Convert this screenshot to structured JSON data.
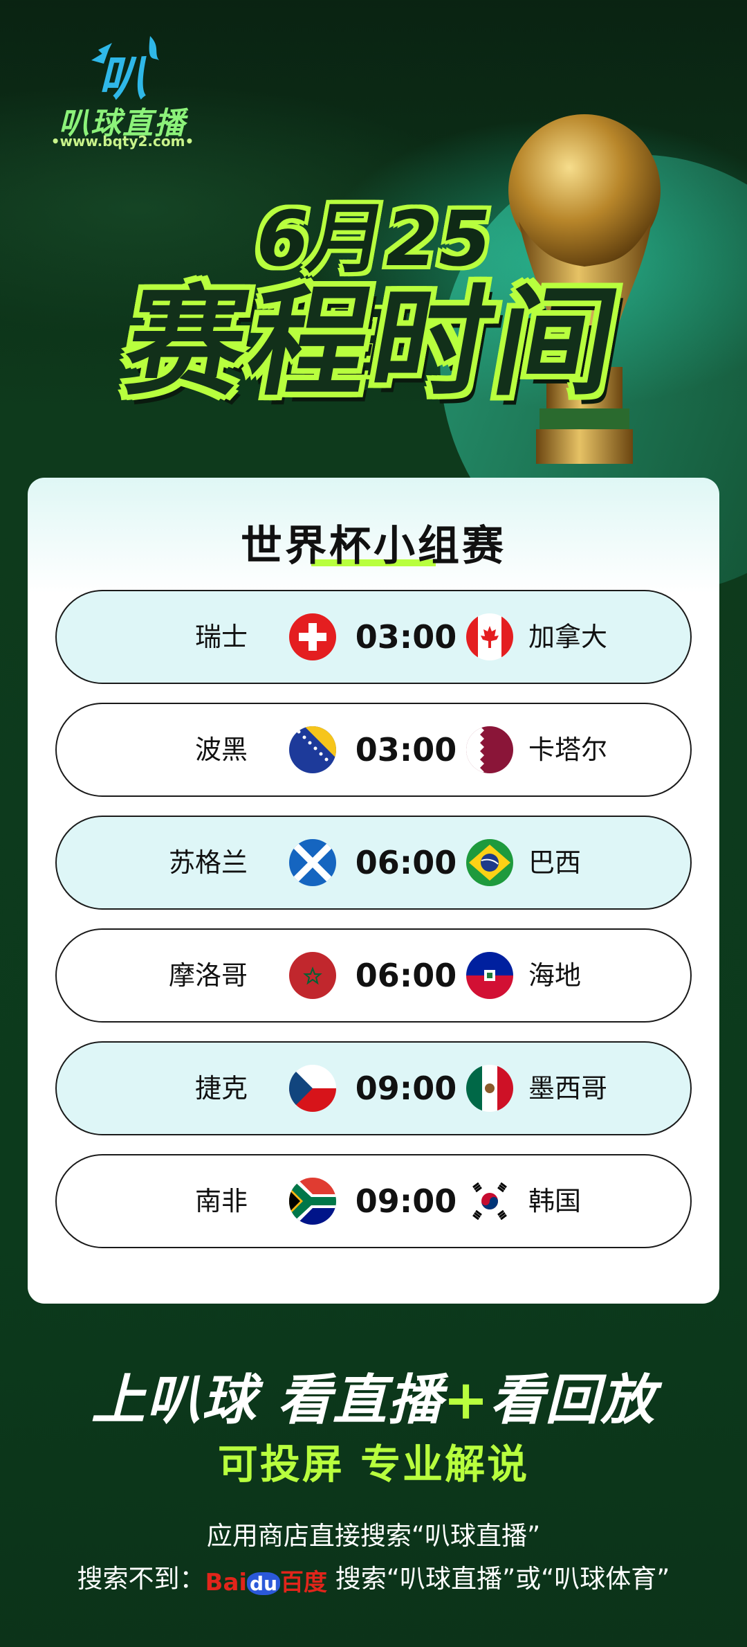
{
  "brand": {
    "name": "叭球直播",
    "url": "•www.bqty2.com•"
  },
  "header": {
    "date": "6月25日",
    "title": "赛程时间"
  },
  "card": {
    "title": "世界杯小组赛"
  },
  "matches": [
    {
      "home": "瑞士",
      "time": "03:00",
      "away": "加拿大",
      "home_flag": "switzerland-flag-icon",
      "away_flag": "canada-flag-icon"
    },
    {
      "home": "波黑",
      "time": "03:00",
      "away": "卡塔尔",
      "home_flag": "bosnia-flag-icon",
      "away_flag": "qatar-flag-icon"
    },
    {
      "home": "苏格兰",
      "time": "06:00",
      "away": "巴西",
      "home_flag": "scotland-flag-icon",
      "away_flag": "brazil-flag-icon"
    },
    {
      "home": "摩洛哥",
      "time": "06:00",
      "away": "海地",
      "home_flag": "morocco-flag-icon",
      "away_flag": "haiti-flag-icon"
    },
    {
      "home": "捷克",
      "time": "09:00",
      "away": "墨西哥",
      "home_flag": "czech-flag-icon",
      "away_flag": "mexico-flag-icon"
    },
    {
      "home": "南非",
      "time": "09:00",
      "away": "韩国",
      "home_flag": "south-africa-flag-icon",
      "away_flag": "south-korea-flag-icon"
    }
  ],
  "footer": {
    "slogan_a": "上叭球  看直播",
    "slogan_plus": "+",
    "slogan_b": "看回放",
    "slogan2": "可投屏 专业解说",
    "tip1": "应用商店直接搜索“叭球直播”",
    "tip2_prefix": "搜索不到：",
    "baidu_a": "Bai",
    "baidu_du": "du",
    "baidu_b": "百度",
    "tip2_suffix": " 搜索“叭球直播”或“叭球体育”"
  },
  "colors": {
    "accent": "#b8ff3e",
    "background": "#0d3a1d",
    "row_alt": "#def6f7"
  }
}
